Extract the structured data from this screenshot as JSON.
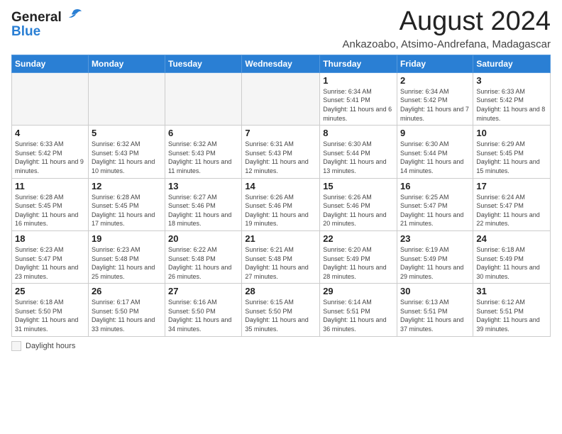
{
  "header": {
    "logo_general": "General",
    "logo_blue": "Blue",
    "main_title": "August 2024",
    "subtitle": "Ankazoabo, Atsimo-Andrefana, Madagascar"
  },
  "calendar": {
    "weekdays": [
      "Sunday",
      "Monday",
      "Tuesday",
      "Wednesday",
      "Thursday",
      "Friday",
      "Saturday"
    ],
    "weeks": [
      [
        {
          "day": "",
          "info": ""
        },
        {
          "day": "",
          "info": ""
        },
        {
          "day": "",
          "info": ""
        },
        {
          "day": "",
          "info": ""
        },
        {
          "day": "1",
          "info": "Sunrise: 6:34 AM\nSunset: 5:41 PM\nDaylight: 11 hours and 6 minutes."
        },
        {
          "day": "2",
          "info": "Sunrise: 6:34 AM\nSunset: 5:42 PM\nDaylight: 11 hours and 7 minutes."
        },
        {
          "day": "3",
          "info": "Sunrise: 6:33 AM\nSunset: 5:42 PM\nDaylight: 11 hours and 8 minutes."
        }
      ],
      [
        {
          "day": "4",
          "info": "Sunrise: 6:33 AM\nSunset: 5:42 PM\nDaylight: 11 hours and 9 minutes."
        },
        {
          "day": "5",
          "info": "Sunrise: 6:32 AM\nSunset: 5:43 PM\nDaylight: 11 hours and 10 minutes."
        },
        {
          "day": "6",
          "info": "Sunrise: 6:32 AM\nSunset: 5:43 PM\nDaylight: 11 hours and 11 minutes."
        },
        {
          "day": "7",
          "info": "Sunrise: 6:31 AM\nSunset: 5:43 PM\nDaylight: 11 hours and 12 minutes."
        },
        {
          "day": "8",
          "info": "Sunrise: 6:30 AM\nSunset: 5:44 PM\nDaylight: 11 hours and 13 minutes."
        },
        {
          "day": "9",
          "info": "Sunrise: 6:30 AM\nSunset: 5:44 PM\nDaylight: 11 hours and 14 minutes."
        },
        {
          "day": "10",
          "info": "Sunrise: 6:29 AM\nSunset: 5:45 PM\nDaylight: 11 hours and 15 minutes."
        }
      ],
      [
        {
          "day": "11",
          "info": "Sunrise: 6:28 AM\nSunset: 5:45 PM\nDaylight: 11 hours and 16 minutes."
        },
        {
          "day": "12",
          "info": "Sunrise: 6:28 AM\nSunset: 5:45 PM\nDaylight: 11 hours and 17 minutes."
        },
        {
          "day": "13",
          "info": "Sunrise: 6:27 AM\nSunset: 5:46 PM\nDaylight: 11 hours and 18 minutes."
        },
        {
          "day": "14",
          "info": "Sunrise: 6:26 AM\nSunset: 5:46 PM\nDaylight: 11 hours and 19 minutes."
        },
        {
          "day": "15",
          "info": "Sunrise: 6:26 AM\nSunset: 5:46 PM\nDaylight: 11 hours and 20 minutes."
        },
        {
          "day": "16",
          "info": "Sunrise: 6:25 AM\nSunset: 5:47 PM\nDaylight: 11 hours and 21 minutes."
        },
        {
          "day": "17",
          "info": "Sunrise: 6:24 AM\nSunset: 5:47 PM\nDaylight: 11 hours and 22 minutes."
        }
      ],
      [
        {
          "day": "18",
          "info": "Sunrise: 6:23 AM\nSunset: 5:47 PM\nDaylight: 11 hours and 23 minutes."
        },
        {
          "day": "19",
          "info": "Sunrise: 6:23 AM\nSunset: 5:48 PM\nDaylight: 11 hours and 25 minutes."
        },
        {
          "day": "20",
          "info": "Sunrise: 6:22 AM\nSunset: 5:48 PM\nDaylight: 11 hours and 26 minutes."
        },
        {
          "day": "21",
          "info": "Sunrise: 6:21 AM\nSunset: 5:48 PM\nDaylight: 11 hours and 27 minutes."
        },
        {
          "day": "22",
          "info": "Sunrise: 6:20 AM\nSunset: 5:49 PM\nDaylight: 11 hours and 28 minutes."
        },
        {
          "day": "23",
          "info": "Sunrise: 6:19 AM\nSunset: 5:49 PM\nDaylight: 11 hours and 29 minutes."
        },
        {
          "day": "24",
          "info": "Sunrise: 6:18 AM\nSunset: 5:49 PM\nDaylight: 11 hours and 30 minutes."
        }
      ],
      [
        {
          "day": "25",
          "info": "Sunrise: 6:18 AM\nSunset: 5:50 PM\nDaylight: 11 hours and 31 minutes."
        },
        {
          "day": "26",
          "info": "Sunrise: 6:17 AM\nSunset: 5:50 PM\nDaylight: 11 hours and 33 minutes."
        },
        {
          "day": "27",
          "info": "Sunrise: 6:16 AM\nSunset: 5:50 PM\nDaylight: 11 hours and 34 minutes."
        },
        {
          "day": "28",
          "info": "Sunrise: 6:15 AM\nSunset: 5:50 PM\nDaylight: 11 hours and 35 minutes."
        },
        {
          "day": "29",
          "info": "Sunrise: 6:14 AM\nSunset: 5:51 PM\nDaylight: 11 hours and 36 minutes."
        },
        {
          "day": "30",
          "info": "Sunrise: 6:13 AM\nSunset: 5:51 PM\nDaylight: 11 hours and 37 minutes."
        },
        {
          "day": "31",
          "info": "Sunrise: 6:12 AM\nSunset: 5:51 PM\nDaylight: 11 hours and 39 minutes."
        }
      ]
    ]
  },
  "footer": {
    "daylight_label": "Daylight hours"
  }
}
